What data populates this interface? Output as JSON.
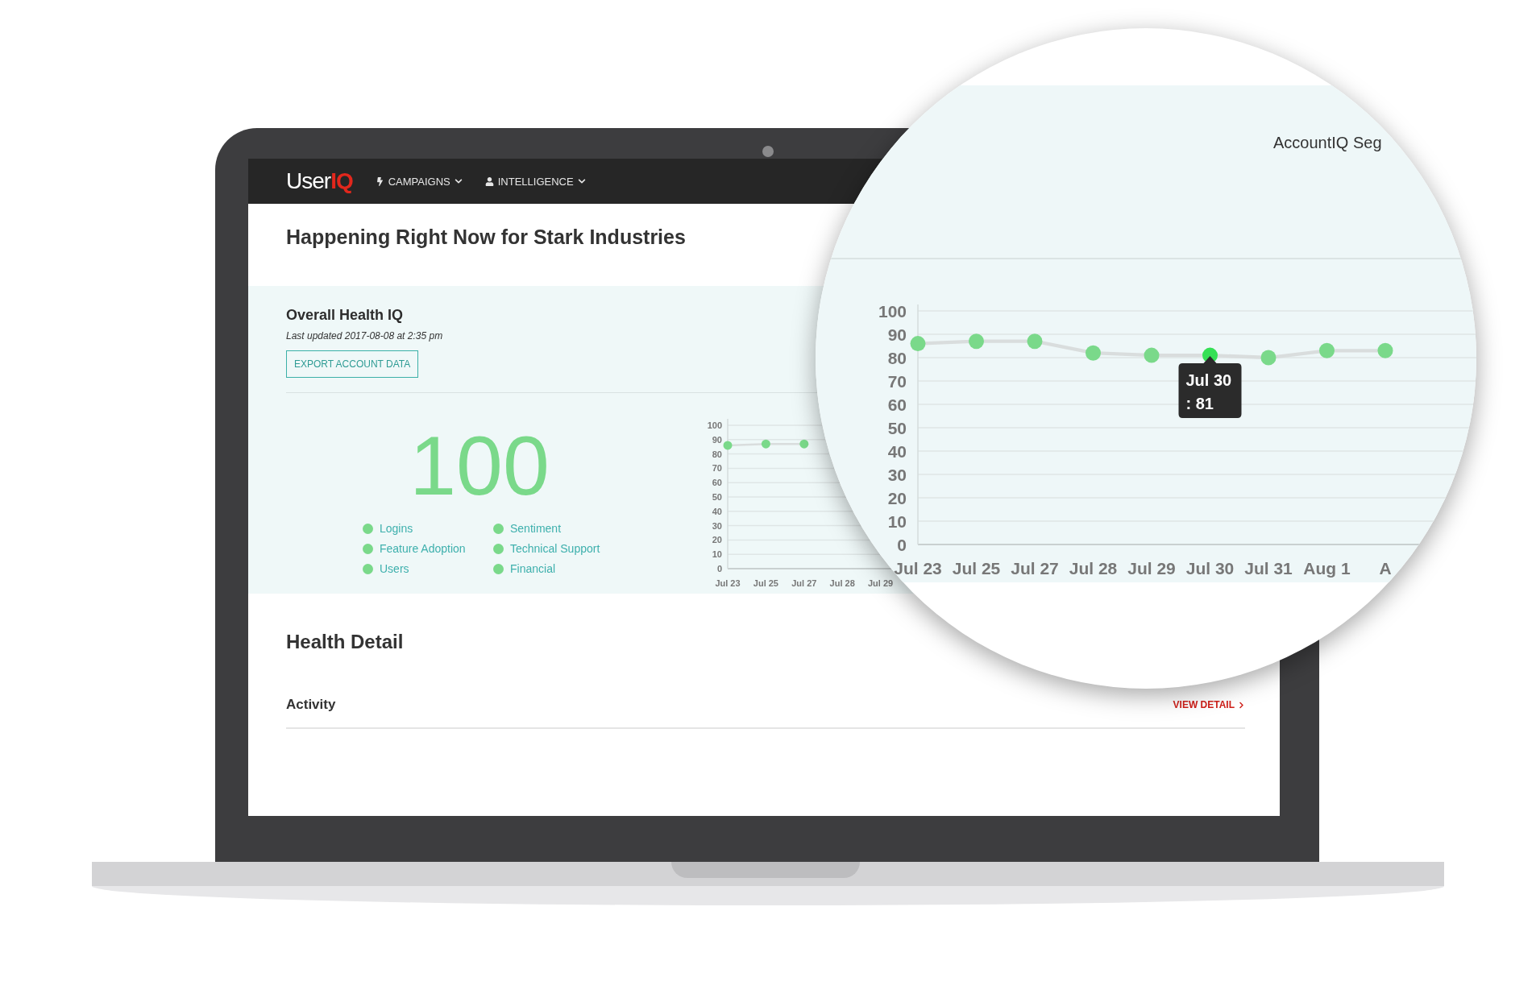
{
  "nav": {
    "logo_main": "User",
    "logo_accent": "IQ",
    "items": [
      {
        "label": "CAMPAIGNS"
      },
      {
        "label": "INTELLIGENCE"
      }
    ]
  },
  "page_title": "Happening Right Now for Stark Industries",
  "health": {
    "title": "Overall Health IQ",
    "updated": "Last updated 2017-08-08 at 2:35 pm",
    "export_button": "EXPORT ACCOUNT DATA",
    "score": "100",
    "legend": [
      "Logins",
      "Sentiment",
      "Feature Adoption",
      "Technical Support",
      "Users",
      "Financial"
    ],
    "chart_data": {
      "type": "line",
      "categories": [
        "Jul 23",
        "Jul 25",
        "Jul 27",
        "Jul 28",
        "Jul 29"
      ],
      "series": [
        {
          "color": "#7ad98a",
          "marker": "circle",
          "values": [
            86,
            87,
            87,
            null,
            null
          ]
        }
      ],
      "ylim": [
        0,
        100
      ],
      "yticks": [
        0,
        10,
        20,
        30,
        40,
        50,
        60,
        70,
        80,
        90,
        {
          "value": 100,
          "label": "100"
        }
      ],
      "grid": true
    }
  },
  "detail": {
    "title": "Health Detail",
    "rows": [
      {
        "label": "Activity",
        "link": "VIEW DETAIL"
      }
    ]
  },
  "magnifier": {
    "heading": "AccountIQ Seg",
    "chart_data": {
      "type": "line",
      "categories": [
        "Jul 23",
        "Jul 25",
        "Jul 27",
        "Jul 28",
        "Jul 29",
        "Jul 30",
        "Jul 31",
        "Aug 1",
        "A"
      ],
      "series": [
        {
          "color": "#7ad98a",
          "marker": "circle",
          "values": [
            86,
            87,
            87,
            82,
            81,
            81,
            80,
            83,
            83
          ]
        }
      ],
      "ylim": [
        0,
        100
      ],
      "yticks": [
        0,
        10,
        20,
        30,
        40,
        50,
        60,
        70,
        80,
        90,
        {
          "value": 100,
          "label": "100"
        }
      ],
      "grid": true,
      "annotations": [
        {
          "x": "Jul 30",
          "y": 81,
          "text": "Jul 30\n: 81"
        }
      ]
    }
  }
}
